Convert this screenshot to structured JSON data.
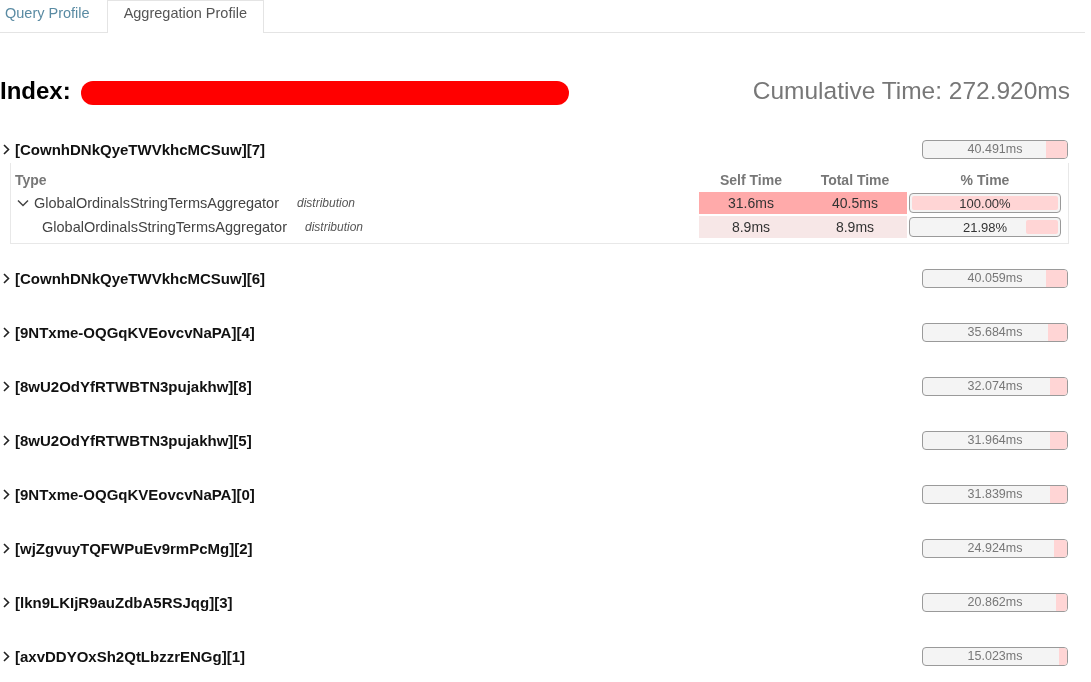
{
  "tabs": [
    {
      "label": "Query Profile",
      "selected": false
    },
    {
      "label": "Aggregation Profile",
      "selected": true
    }
  ],
  "header": {
    "index_label": "Index:",
    "name_redacted": true,
    "cumulative_time": "Cumulative Time: 272.920ms"
  },
  "shards": [
    {
      "name": "[CownhDNkQyeTWVkhcMCSuw][7]",
      "time": "40.491ms",
      "level": 0.148,
      "aggregations": {
        "columns": [
          "Type",
          "Self Time",
          "Total Time",
          "% Time"
        ],
        "rows": [
          {
            "name": "GlobalOrdinalsStringTermsAggregator",
            "description": "distribution",
            "self_time": "31.6ms",
            "total_time": "40.5ms",
            "percent": "100.00%",
            "level": 1,
            "expanded": true,
            "children": [
              {
                "name": "GlobalOrdinalsStringTermsAggregator",
                "description": "distribution",
                "self_time": "8.9ms",
                "total_time": "8.9ms",
                "percent": "21.98%",
                "level": 0.2198
              }
            ]
          }
        ]
      }
    },
    {
      "name": "[CownhDNkQyeTWVkhcMCSuw][6]",
      "time": "40.059ms",
      "level": 0.147
    },
    {
      "name": "[9NTxme-OQGqKVEovcvNaPA][4]",
      "time": "35.684ms",
      "level": 0.131
    },
    {
      "name": "[8wU2OdYfRTWBTN3pujakhw][8]",
      "time": "32.074ms",
      "level": 0.118
    },
    {
      "name": "[8wU2OdYfRTWBTN3pujakhw][5]",
      "time": "31.964ms",
      "level": 0.117
    },
    {
      "name": "[9NTxme-OQGqKVEovcvNaPA][0]",
      "time": "31.839ms",
      "level": 0.117
    },
    {
      "name": "[wjZgvuyTQFWPuEv9rmPcMg][2]",
      "time": "24.924ms",
      "level": 0.091
    },
    {
      "name": "[lkn9LKIjR9auZdbA5RSJqg][3]",
      "time": "20.862ms",
      "level": 0.076
    },
    {
      "name": "[axvDDYOxSh2QtLbzzrENGg][1]",
      "time": "15.023ms",
      "level": 0.055
    }
  ]
}
